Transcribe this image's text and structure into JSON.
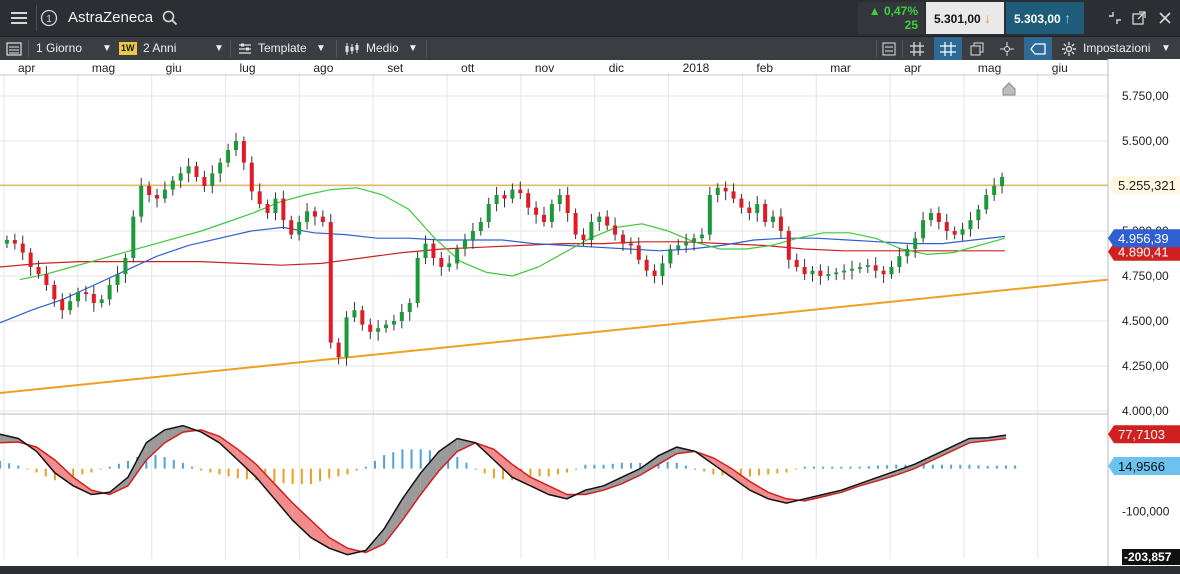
{
  "header": {
    "menu_icon": "menu-icon",
    "info_icon": "info-icon",
    "instrument": "AstraZeneca",
    "search_icon": "search-icon",
    "change_pct": "▲ 0,47%",
    "change_abs": "25",
    "bid": "5.301,00",
    "ask": "5.303,00",
    "colors": {
      "bg": "#2b2e33",
      "up": "#3bd23b",
      "bid_arrow": "#e8a020",
      "ask_arrow": "#4aa3df"
    }
  },
  "toolbar": {
    "interval": "1 Giorno",
    "badge": "1W",
    "period": "2 Anni",
    "template": "Template",
    "medio": "Medio",
    "settings": "Impostazioni"
  },
  "chart_data": {
    "type": "candlestick",
    "months": [
      "apr",
      "mag",
      "giu",
      "lug",
      "ago",
      "set",
      "ott",
      "nov",
      "dic",
      "2018",
      "feb",
      "mar",
      "apr",
      "mag",
      "giu"
    ],
    "price_axis": {
      "ylim": [
        4000,
        5800
      ],
      "ticks": [
        "5.750,00",
        "5.500,00",
        "5.250,00",
        "5.000,00",
        "4.750,00",
        "4.500,00",
        "4.250,00",
        "4.000,00"
      ]
    },
    "price_labels": {
      "horizontal_line": "5.255,321",
      "sma_blue": "4.956,39",
      "sma_red": "4.890,41"
    },
    "horizontal_line_value": 5255,
    "trendline": {
      "start": 4100,
      "end": 4730
    },
    "close_series": [
      4950,
      4930,
      4880,
      4800,
      4760,
      4700,
      4620,
      4560,
      4610,
      4660,
      4650,
      4600,
      4620,
      4700,
      4760,
      4850,
      5080,
      5250,
      5200,
      5180,
      5230,
      5280,
      5320,
      5360,
      5300,
      5250,
      5320,
      5380,
      5450,
      5500,
      5380,
      5220,
      5150,
      5100,
      5180,
      5060,
      4980,
      5050,
      5110,
      5080,
      5050,
      4380,
      4300,
      4520,
      4560,
      4480,
      4440,
      4460,
      4480,
      4500,
      4550,
      4600,
      4850,
      4930,
      4850,
      4800,
      4820,
      4900,
      4950,
      5000,
      5050,
      5150,
      5200,
      5180,
      5230,
      5210,
      5130,
      5090,
      5050,
      5150,
      5200,
      5100,
      4980,
      4950,
      5050,
      5080,
      5030,
      4980,
      4930,
      4920,
      4840,
      4780,
      4750,
      4820,
      4900,
      4920,
      4940,
      4960,
      4980,
      5200,
      5240,
      5220,
      5180,
      5130,
      5100,
      5150,
      5050,
      5080,
      5000,
      4840,
      4800,
      4760,
      4780,
      4750,
      4760,
      4770,
      4780,
      4790,
      4800,
      4810,
      4780,
      4760,
      4800,
      4860,
      4900,
      4960,
      5060,
      5100,
      5050,
      5000,
      4980,
      5010,
      5060,
      5120,
      5200,
      5250,
      5300
    ],
    "sma_green": [
      4730,
      4760,
      4800,
      4840,
      4880,
      4920,
      4960,
      5000,
      5050,
      5100,
      5160,
      5200,
      5230,
      5240,
      5200,
      5120,
      4960,
      4830,
      4770,
      4750,
      4800,
      4880,
      4960,
      5020,
      5040,
      5000,
      4940,
      4900,
      4900,
      4920,
      4960,
      4990,
      4990,
      4960,
      4900,
      4870,
      4880,
      4920,
      4960
    ],
    "sma_blue": [
      4490,
      4560,
      4620,
      4700,
      4780,
      4860,
      4920,
      4960,
      5000,
      5020,
      4990,
      4980,
      4960,
      4960,
      4950,
      4950,
      4950,
      4930,
      4920,
      4910,
      4900,
      4890,
      4900,
      4920,
      4950,
      4960,
      4960,
      4950,
      4940,
      4930,
      4930,
      4950,
      4970
    ],
    "sma_red": [
      4800,
      4820,
      4830,
      4830,
      4830,
      4830,
      4820,
      4810,
      4820,
      4850,
      4880,
      4900,
      4910,
      4920,
      4930,
      4930,
      4940,
      4940,
      4930,
      4920,
      4900,
      4890,
      4890,
      4890,
      4890,
      4890
    ],
    "oscillator": {
      "ticks": [
        "-100,000"
      ],
      "labels": {
        "macd": "77,7103",
        "histogram": "14,9566",
        "min": "-203,857"
      },
      "ylim": [
        -210,
        120
      ],
      "macd": [
        80,
        70,
        40,
        -10,
        -40,
        -60,
        -55,
        -20,
        60,
        90,
        100,
        85,
        60,
        20,
        -20,
        -70,
        -120,
        -160,
        -185,
        -200,
        -190,
        -140,
        -70,
        -10,
        40,
        70,
        60,
        20,
        -20,
        -40,
        -60,
        -70,
        -50,
        -40,
        -20,
        0,
        30,
        50,
        40,
        10,
        -20,
        -50,
        -70,
        -80,
        -70,
        -60,
        -50,
        -35,
        -20,
        -5,
        10,
        30,
        50,
        70,
        72,
        78
      ],
      "signal": [
        60,
        62,
        50,
        20,
        -20,
        -50,
        -60,
        -40,
        20,
        60,
        85,
        90,
        75,
        45,
        10,
        -35,
        -80,
        -120,
        -160,
        -185,
        -195,
        -175,
        -120,
        -60,
        -5,
        40,
        60,
        45,
        10,
        -20,
        -40,
        -60,
        -60,
        -50,
        -35,
        -15,
        10,
        35,
        40,
        25,
        0,
        -30,
        -55,
        -70,
        -75,
        -65,
        -55,
        -40,
        -28,
        -15,
        0,
        20,
        40,
        60,
        65,
        70
      ]
    },
    "colors": {
      "up": "#1a9a3a",
      "down": "#e01b24",
      "green_ma": "#3cc83c",
      "blue_ma": "#2f5fd0",
      "red_ma": "#cc2222",
      "trend": "#f0a020",
      "hline": "#e0a020",
      "hist_pos": "#4aa3df",
      "hist_neg": "#e8a020"
    }
  }
}
